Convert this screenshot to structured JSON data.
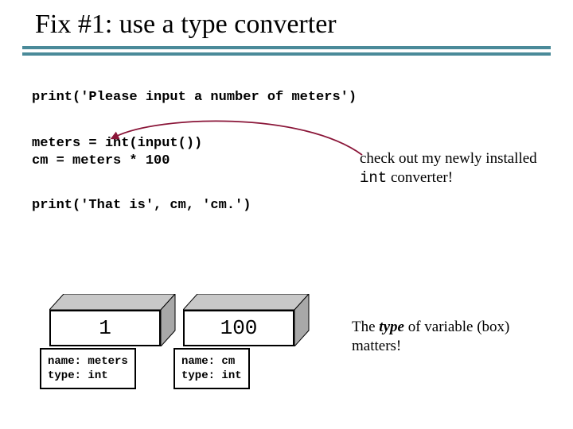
{
  "title": "Fix #1:  use a type converter",
  "code": {
    "line1": "print('Please input a number of meters')",
    "line2a": "meters = int(input())",
    "line2b": "cm = meters * 100",
    "line3": "print('That is', cm, 'cm.')"
  },
  "annot1": {
    "part1": "check out my newly installed ",
    "mono": "int",
    "part2": "  converter!"
  },
  "annot2": {
    "part1": "The ",
    "bold": "type",
    "part2": " of variable (box) matters!"
  },
  "box1": {
    "value": "1",
    "name_label": "name:",
    "name_value": "meters",
    "type_label": "type:",
    "type_value": "int"
  },
  "box2": {
    "value": "100",
    "name_label": "name:",
    "name_value": "cm",
    "type_label": "type:",
    "type_value": "int"
  }
}
